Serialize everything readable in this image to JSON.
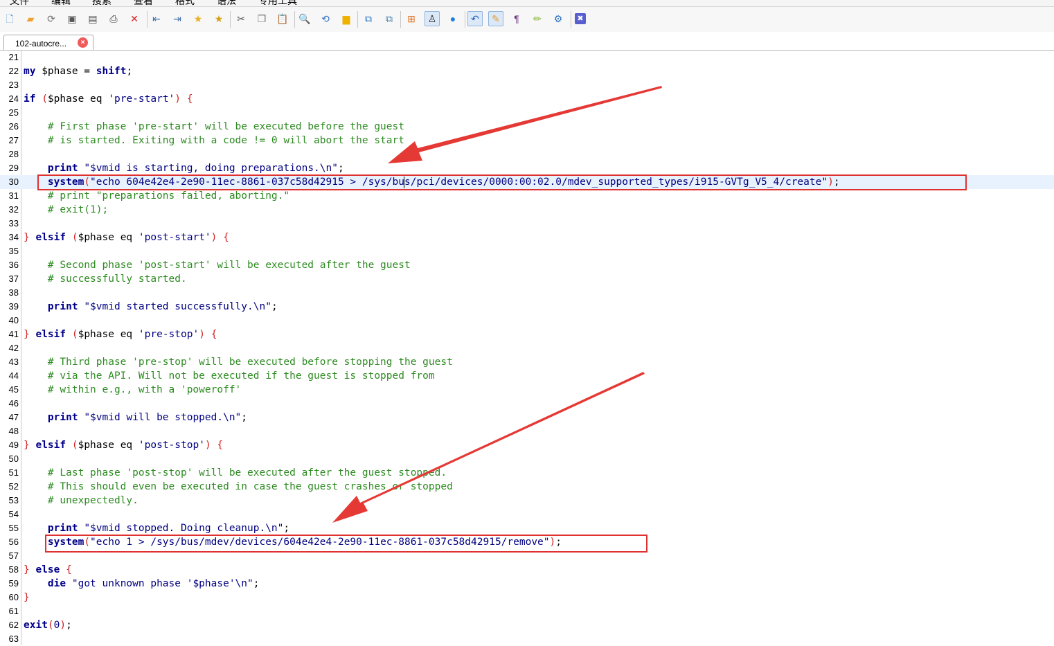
{
  "menubar": {
    "items": [
      "文件",
      "编辑",
      "搜索",
      "查看",
      "格式",
      "语法",
      "专用工具"
    ]
  },
  "toolbar": {
    "buttons": [
      {
        "icon": "new-file-icon",
        "glyph": "🗋",
        "color": "#5b9bd5"
      },
      {
        "icon": "open-folder-icon",
        "glyph": "▰",
        "color": "#f0a030"
      },
      {
        "icon": "reload-icon",
        "glyph": "⟳",
        "color": "#707070"
      },
      {
        "icon": "save-icon",
        "glyph": "▣",
        "color": "#555555"
      },
      {
        "icon": "save-all-icon",
        "glyph": "▤",
        "color": "#555555"
      },
      {
        "icon": "print-icon",
        "glyph": "⎙",
        "color": "#444444"
      },
      {
        "icon": "close-file-icon",
        "glyph": "✕",
        "color": "#e02020"
      },
      {
        "icon": "outdent-icon",
        "glyph": "⇤",
        "color": "#3c6ea8"
      },
      {
        "icon": "indent-icon",
        "glyph": "⇥",
        "color": "#3c6ea8"
      },
      {
        "icon": "bookmark-icon",
        "glyph": "★",
        "color": "#e8b020"
      },
      {
        "icon": "bookmark-list-icon",
        "glyph": "★",
        "color": "#d4a010"
      },
      {
        "icon": "cut-icon",
        "glyph": "✂",
        "color": "#555555"
      },
      {
        "icon": "copy-icon",
        "glyph": "❐",
        "color": "#777777"
      },
      {
        "icon": "paste-icon",
        "glyph": "📋",
        "color": "#777777"
      },
      {
        "icon": "find-icon",
        "glyph": "🔍",
        "color": "#3070c0"
      },
      {
        "icon": "replace-icon",
        "glyph": "⟲",
        "color": "#3070c0"
      },
      {
        "icon": "highlight-icon",
        "glyph": "▆",
        "color": "#f0b000"
      },
      {
        "icon": "compare-icon",
        "glyph": "⧉",
        "color": "#3a80d0"
      },
      {
        "icon": "sync-icon",
        "glyph": "⧉",
        "color": "#4a7fb0"
      },
      {
        "icon": "windows-icon",
        "glyph": "⊞",
        "color": "#e07020"
      },
      {
        "icon": "linux-icon",
        "glyph": "♙",
        "color": "#222222"
      },
      {
        "icon": "apple-icon",
        "glyph": "●",
        "color": "#1f7fe0"
      },
      {
        "icon": "undo-icon",
        "glyph": "↶",
        "color": "#1f5fbf"
      },
      {
        "icon": "macro-icon",
        "glyph": "✎",
        "color": "#e0a030"
      },
      {
        "icon": "paragraph-icon",
        "glyph": "¶",
        "color": "#6a2a80"
      },
      {
        "icon": "pen-icon",
        "glyph": "✏",
        "color": "#7ab020"
      },
      {
        "icon": "settings-icon",
        "glyph": "⚙",
        "color": "#2a6fc0"
      },
      {
        "icon": "exit-icon",
        "glyph": "✖",
        "color": "#ffffff"
      }
    ]
  },
  "tab": {
    "label": "102-autocre...",
    "close_glyph": "×"
  },
  "editor": {
    "lines": [
      {
        "n": "21",
        "html": ""
      },
      {
        "n": "22",
        "html": "<span class='kw'>my</span> $phase = <span class='kw'>shift</span>;"
      },
      {
        "n": "23",
        "html": ""
      },
      {
        "n": "24",
        "html": "<span class='kw'>if</span> <span class='br'>(</span>$phase eq <span class='st'>'pre-start'</span><span class='br'>)</span> <span class='br'>{</span>"
      },
      {
        "n": "25",
        "html": ""
      },
      {
        "n": "26",
        "html": "    <span class='cm'># First phase 'pre-start' will be executed before the guest</span>"
      },
      {
        "n": "27",
        "html": "    <span class='cm'># is started. Exiting with a code != 0 will abort the start</span>"
      },
      {
        "n": "28",
        "html": ""
      },
      {
        "n": "29",
        "html": "    <span class='kw'>print</span> <span class='st'>\"$vmid is starting, doing preparations.\\n\"</span>;"
      },
      {
        "n": "30",
        "html": "    <span class='kw'>system</span><span class='br'>(</span><span class='st'>\"echo 604e42e4-2e90-11ec-8861-037c58d42915 > /sys/bus/pci/devices/0000:00:02.0/mdev_supported_types/i915-GVTg_V5_4/create\"</span><span class='br'>)</span>;"
      },
      {
        "n": "31",
        "html": "    <span class='cm'># print \"preparations failed, aborting.\"</span>"
      },
      {
        "n": "32",
        "html": "    <span class='cm'># exit(1);</span>"
      },
      {
        "n": "33",
        "html": ""
      },
      {
        "n": "34",
        "html": "<span class='br'>}</span> <span class='kw'>elsif</span> <span class='br'>(</span>$phase eq <span class='st'>'post-start'</span><span class='br'>)</span> <span class='br'>{</span>"
      },
      {
        "n": "35",
        "html": ""
      },
      {
        "n": "36",
        "html": "    <span class='cm'># Second phase 'post-start' will be executed after the guest</span>"
      },
      {
        "n": "37",
        "html": "    <span class='cm'># successfully started.</span>"
      },
      {
        "n": "38",
        "html": ""
      },
      {
        "n": "39",
        "html": "    <span class='kw'>print</span> <span class='st'>\"$vmid started successfully.\\n\"</span>;"
      },
      {
        "n": "40",
        "html": ""
      },
      {
        "n": "41",
        "html": "<span class='br'>}</span> <span class='kw'>elsif</span> <span class='br'>(</span>$phase eq <span class='st'>'pre-stop'</span><span class='br'>)</span> <span class='br'>{</span>"
      },
      {
        "n": "42",
        "html": ""
      },
      {
        "n": "43",
        "html": "    <span class='cm'># Third phase 'pre-stop' will be executed before stopping the guest</span>"
      },
      {
        "n": "44",
        "html": "    <span class='cm'># via the API. Will not be executed if the guest is stopped from</span>"
      },
      {
        "n": "45",
        "html": "    <span class='cm'># within e.g., with a 'poweroff'</span>"
      },
      {
        "n": "46",
        "html": ""
      },
      {
        "n": "47",
        "html": "    <span class='kw'>print</span> <span class='st'>\"$vmid will be stopped.\\n\"</span>;"
      },
      {
        "n": "48",
        "html": ""
      },
      {
        "n": "49",
        "html": "<span class='br'>}</span> <span class='kw'>elsif</span> <span class='br'>(</span>$phase eq <span class='st'>'post-stop'</span><span class='br'>)</span> <span class='br'>{</span>"
      },
      {
        "n": "50",
        "html": ""
      },
      {
        "n": "51",
        "html": "    <span class='cm'># Last phase 'post-stop' will be executed after the guest stopped.</span>"
      },
      {
        "n": "52",
        "html": "    <span class='cm'># This should even be executed in case the guest crashes or stopped</span>"
      },
      {
        "n": "53",
        "html": "    <span class='cm'># unexpectedly.</span>"
      },
      {
        "n": "54",
        "html": ""
      },
      {
        "n": "55",
        "html": "    <span class='kw'>print</span> <span class='st'>\"$vmid stopped. Doing cleanup.\\n\"</span>;"
      },
      {
        "n": "56",
        "html": "    <span class='kw'>system</span><span class='br'>(</span><span class='st'>\"echo 1 > /sys/bus/mdev/devices/604e42e4-2e90-11ec-8861-037c58d42915/remove\"</span><span class='br'>)</span>;"
      },
      {
        "n": "57",
        "html": ""
      },
      {
        "n": "58",
        "html": "<span class='br'>}</span> <span class='kw'>else</span> <span class='br'>{</span>"
      },
      {
        "n": "59",
        "html": "    <span class='kw'>die</span> <span class='st'>\"got unknown phase '$phase'\\n\"</span>;"
      },
      {
        "n": "60",
        "html": "<span class='br'>}</span>"
      },
      {
        "n": "61",
        "html": ""
      },
      {
        "n": "62",
        "html": "<span class='kw'>exit</span><span class='br'>(</span><span class='st'>0</span><span class='br'>)</span>;"
      },
      {
        "n": "63",
        "html": ""
      }
    ],
    "current_line": "30"
  },
  "colors": {
    "highlight_box": "#e03131",
    "arrow": "#e53935",
    "current_line_bg": "#e8f2fe"
  }
}
